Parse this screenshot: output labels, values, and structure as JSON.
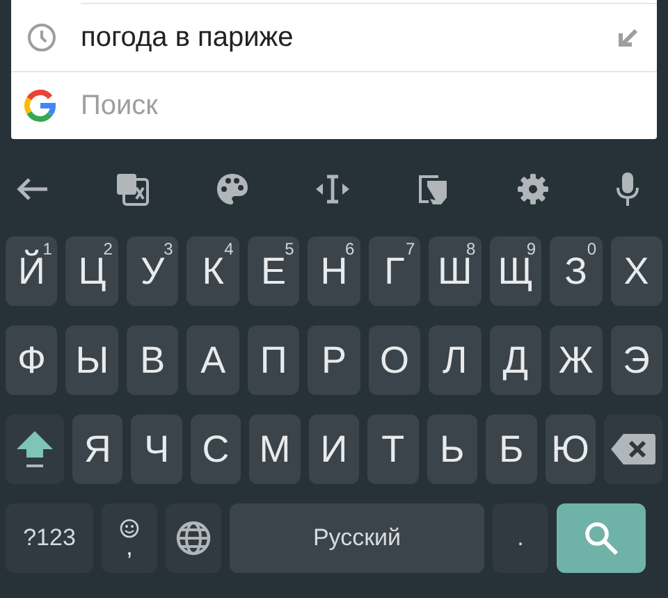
{
  "suggestions": [
    {
      "text": "погода в париже"
    }
  ],
  "search": {
    "placeholder": "Поиск"
  },
  "rows": [
    [
      {
        "kind": "letter",
        "label": "Й",
        "hint": "1"
      },
      {
        "kind": "letter",
        "label": "Ц",
        "hint": "2"
      },
      {
        "kind": "letter",
        "label": "У",
        "hint": "3"
      },
      {
        "kind": "letter",
        "label": "К",
        "hint": "4"
      },
      {
        "kind": "letter",
        "label": "Е",
        "hint": "5"
      },
      {
        "kind": "letter",
        "label": "Н",
        "hint": "6"
      },
      {
        "kind": "letter",
        "label": "Г",
        "hint": "7"
      },
      {
        "kind": "letter",
        "label": "Ш",
        "hint": "8"
      },
      {
        "kind": "letter",
        "label": "Щ",
        "hint": "9"
      },
      {
        "kind": "letter",
        "label": "З",
        "hint": "0"
      },
      {
        "kind": "letter",
        "label": "Х"
      }
    ],
    [
      {
        "kind": "letter",
        "label": "Ф"
      },
      {
        "kind": "letter",
        "label": "Ы"
      },
      {
        "kind": "letter",
        "label": "В"
      },
      {
        "kind": "letter",
        "label": "А"
      },
      {
        "kind": "letter",
        "label": "П"
      },
      {
        "kind": "letter",
        "label": "Р"
      },
      {
        "kind": "letter",
        "label": "О"
      },
      {
        "kind": "letter",
        "label": "Л"
      },
      {
        "kind": "letter",
        "label": "Д"
      },
      {
        "kind": "letter",
        "label": "Ж"
      },
      {
        "kind": "letter",
        "label": "Э"
      }
    ],
    [
      {
        "kind": "shift",
        "on": true
      },
      {
        "kind": "letter",
        "label": "Я"
      },
      {
        "kind": "letter",
        "label": "Ч"
      },
      {
        "kind": "letter",
        "label": "С"
      },
      {
        "kind": "letter",
        "label": "М"
      },
      {
        "kind": "letter",
        "label": "И"
      },
      {
        "kind": "letter",
        "label": "Т"
      },
      {
        "kind": "letter",
        "label": "Ь"
      },
      {
        "kind": "letter",
        "label": "Б"
      },
      {
        "kind": "letter",
        "label": "Ю"
      },
      {
        "kind": "backspace"
      }
    ],
    [
      {
        "kind": "symbols",
        "label": "?123"
      },
      {
        "kind": "emoji",
        "label": ","
      },
      {
        "kind": "globe"
      },
      {
        "kind": "space",
        "label": "Русский"
      },
      {
        "kind": "period",
        "label": "."
      },
      {
        "kind": "action"
      }
    ]
  ]
}
